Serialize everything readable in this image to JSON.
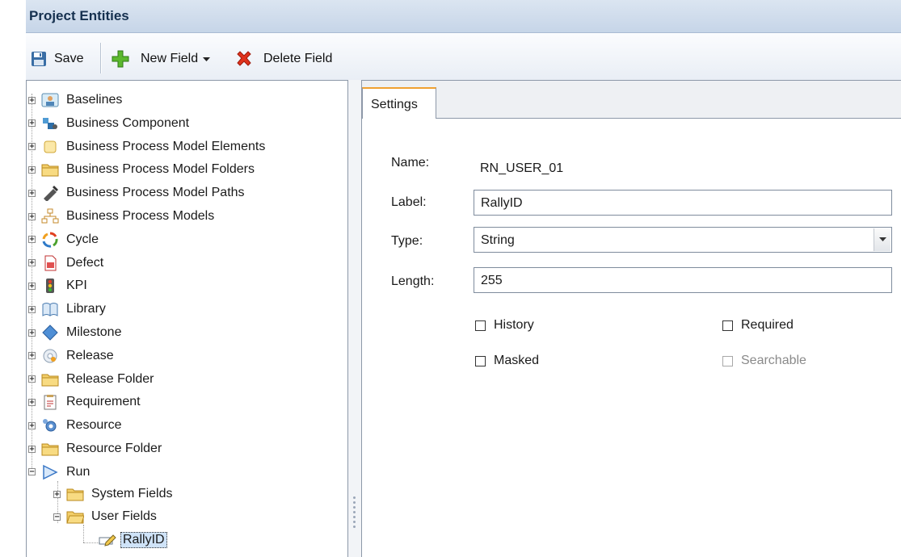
{
  "header": {
    "title": "Project Entities"
  },
  "toolbar": {
    "save_label": "Save",
    "new_field_label": "New Field",
    "delete_field_label": "Delete Field"
  },
  "tree": {
    "items": [
      {
        "label": "Baselines",
        "icon": "baselines-icon"
      },
      {
        "label": "Business Component",
        "icon": "business-component-icon"
      },
      {
        "label": "Business Process Model Elements",
        "icon": "bpm-elements-icon"
      },
      {
        "label": "Business Process Model Folders",
        "icon": "folder-icon"
      },
      {
        "label": "Business Process Model Paths",
        "icon": "bpm-paths-icon"
      },
      {
        "label": "Business Process Models",
        "icon": "bpm-models-icon"
      },
      {
        "label": "Cycle",
        "icon": "cycle-icon"
      },
      {
        "label": "Defect",
        "icon": "defect-icon"
      },
      {
        "label": "KPI",
        "icon": "kpi-icon"
      },
      {
        "label": "Library",
        "icon": "library-icon"
      },
      {
        "label": "Milestone",
        "icon": "milestone-icon"
      },
      {
        "label": "Release",
        "icon": "release-icon"
      },
      {
        "label": "Release Folder",
        "icon": "folder-icon"
      },
      {
        "label": "Requirement",
        "icon": "requirement-icon"
      },
      {
        "label": "Resource",
        "icon": "resource-icon"
      },
      {
        "label": "Resource Folder",
        "icon": "folder-icon"
      },
      {
        "label": "Run",
        "icon": "run-icon"
      }
    ],
    "run_children": [
      {
        "label": "System Fields",
        "icon": "folder-icon"
      },
      {
        "label": "User Fields",
        "icon": "folder-open-icon"
      }
    ],
    "selected_field": "RallyID"
  },
  "settings": {
    "tab_label": "Settings",
    "name_label": "Name:",
    "name_value": "RN_USER_01",
    "label_label": "Label:",
    "label_value": "RallyID",
    "type_label": "Type:",
    "type_value": "String",
    "length_label": "Length:",
    "length_value": "255",
    "history_label": "History",
    "required_label": "Required",
    "masked_label": "Masked",
    "searchable_label": "Searchable"
  }
}
